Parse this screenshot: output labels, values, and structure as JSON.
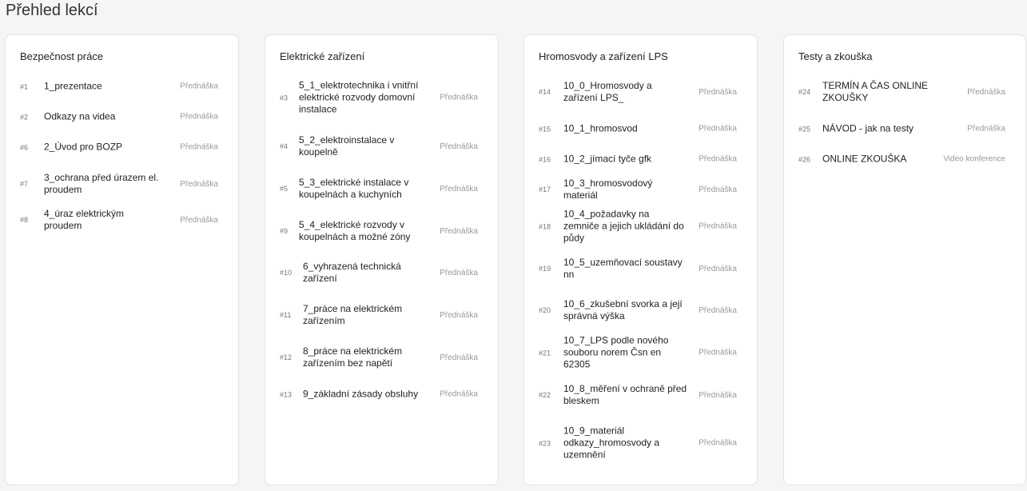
{
  "page_title": "Přehled lekcí",
  "lesson_type_label": "Přednáška",
  "columns": [
    {
      "title": "Bezpečnost práce",
      "lessons": [
        {
          "num": "#1",
          "name": "1_prezentace",
          "type": "Přednáška"
        },
        {
          "num": "#2",
          "name": "Odkazy na videa",
          "type": "Přednáška"
        },
        {
          "num": "#6",
          "name": "2_Úvod pro BOZP",
          "type": "Přednáška"
        },
        {
          "num": "#7",
          "name": "3_ochrana před úrazem el. proudem",
          "type": "Přednáška"
        },
        {
          "num": "#8",
          "name": "4_úraz elektrickým proudem",
          "type": "Přednáška"
        }
      ]
    },
    {
      "title": "Elektrické zařízení",
      "lessons": [
        {
          "num": "#3",
          "name": "5_1_elektrotechnika i vnitřní elektrické rozvody domovní instalace",
          "type": "Přednáška"
        },
        {
          "num": "#4",
          "name": "5_2_elektroinstalace v koupelně",
          "type": "Přednáška"
        },
        {
          "num": "#5",
          "name": "5_3_elektrické instalace v koupelnách a kuchyních",
          "type": "Přednáška"
        },
        {
          "num": "#9",
          "name": "5_4_elektrické rozvody v koupelnách a možné zóny",
          "type": "Přednáška"
        },
        {
          "num": "#10",
          "name": "6_vyhrazená technická zařízení",
          "type": "Přednáška"
        },
        {
          "num": "#11",
          "name": "7_práce na elektrickém zařízením",
          "type": "Přednáška"
        },
        {
          "num": "#12",
          "name": "8_práce na elektrickém zařízením bez napětí",
          "type": "Přednáška"
        },
        {
          "num": "#13",
          "name": "9_základní zásady obsluhy",
          "type": "Přednáška"
        }
      ]
    },
    {
      "title": "Hromosvody a zařízení LPS",
      "lessons": [
        {
          "num": "#14",
          "name": "10_0_Hromosvody a zařízení LPS_",
          "type": "Přednáška"
        },
        {
          "num": "#15",
          "name": "10_1_hromosvod",
          "type": "Přednáška"
        },
        {
          "num": "#16",
          "name": "10_2_jímací tyče gfk",
          "type": "Přednáška"
        },
        {
          "num": "#17",
          "name": "10_3_hromosvodový materiál",
          "type": "Přednáška"
        },
        {
          "num": "#18",
          "name": "10_4_požadavky na zemniče a jejich ukládání do půdy",
          "type": "Přednáška"
        },
        {
          "num": "#19",
          "name": "10_5_uzemňovací soustavy nn",
          "type": "Přednáška"
        },
        {
          "num": "#20",
          "name": "10_6_zkušební svorka a její správná výška",
          "type": "Přednáška"
        },
        {
          "num": "#21",
          "name": "10_7_LPS podle nového souboru norem Čsn en 62305",
          "type": "Přednáška"
        },
        {
          "num": "#22",
          "name": "10_8_měření v ochraně před bleskem",
          "type": "Přednáška"
        },
        {
          "num": "#23",
          "name": "10_9_materiál odkazy_hromosvody a uzemnění",
          "type": "Přednáška"
        }
      ]
    },
    {
      "title": "Testy a zkouška",
      "lessons": [
        {
          "num": "#24",
          "name": "TERMÍN A ČAS ONLINE ZKOUŠKY",
          "type": "Přednáška"
        },
        {
          "num": "#25",
          "name": "NÁVOD - jak na testy",
          "type": "Přednáška"
        },
        {
          "num": "#26",
          "name": "ONLINE ZKOUŠKA",
          "type": "Video konference"
        }
      ]
    }
  ]
}
